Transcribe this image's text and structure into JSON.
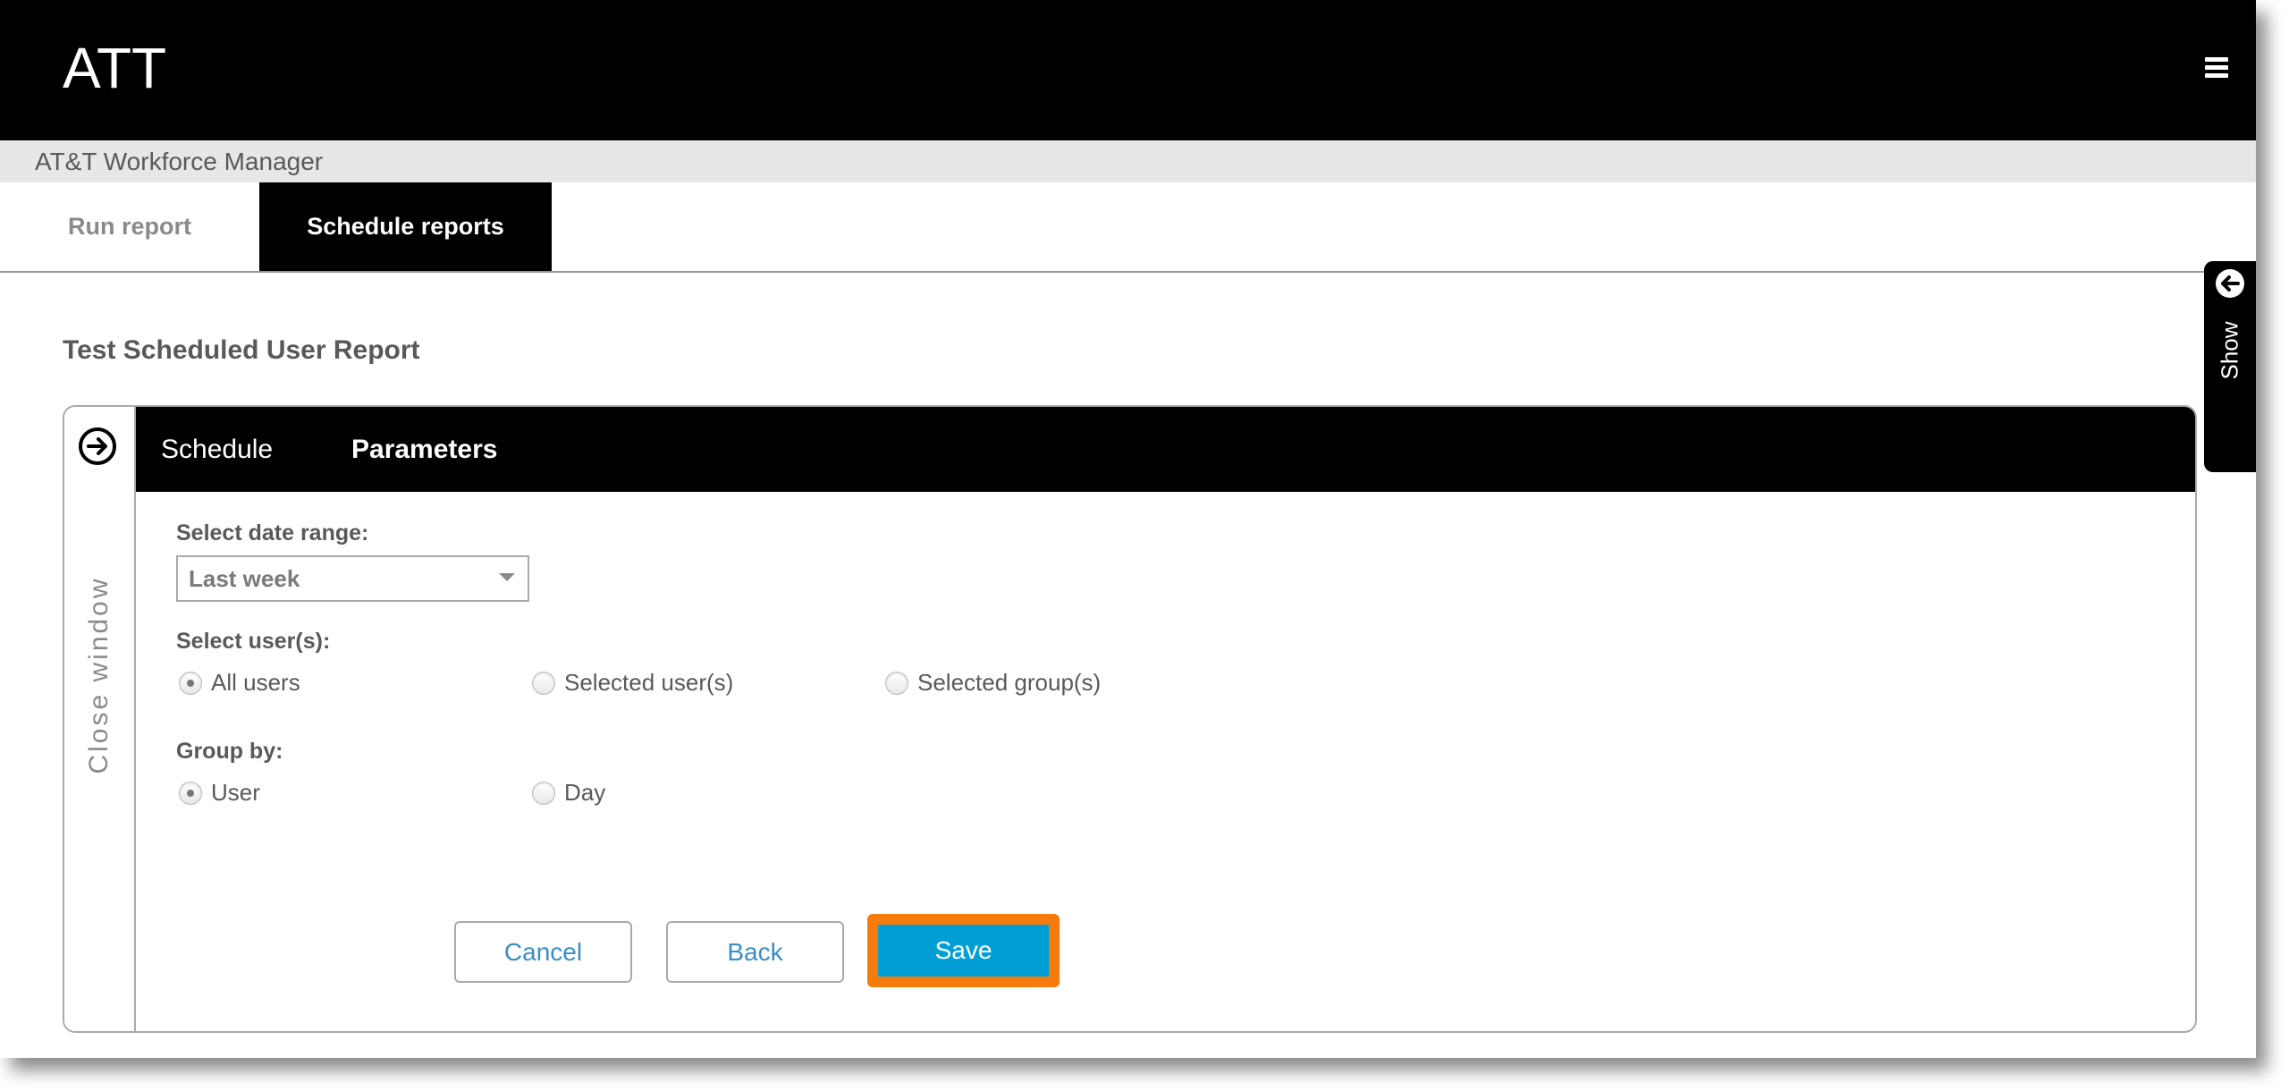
{
  "header": {
    "logo": "ATT",
    "menu_icon": "hamburger-menu-icon"
  },
  "subheader": {
    "app_title": "AT&T Workforce Manager"
  },
  "tabs": [
    {
      "label": "Run report",
      "active": false
    },
    {
      "label": "Schedule reports",
      "active": true
    }
  ],
  "report": {
    "title": "Test Scheduled User Report"
  },
  "panel": {
    "close_label": "Close window",
    "close_icon": "arrow-right-circle-icon",
    "tabs": [
      {
        "label": "Schedule",
        "active": false
      },
      {
        "label": "Parameters",
        "active": true
      }
    ],
    "date_range": {
      "label": "Select date range:",
      "value": "Last week"
    },
    "users": {
      "label": "Select user(s):",
      "options": [
        {
          "label": "All users",
          "checked": true
        },
        {
          "label": "Selected user(s)",
          "checked": false
        },
        {
          "label": "Selected group(s)",
          "checked": false
        }
      ]
    },
    "group_by": {
      "label": "Group by:",
      "options": [
        {
          "label": "User",
          "checked": true
        },
        {
          "label": "Day",
          "checked": false
        }
      ]
    },
    "buttons": {
      "cancel": "Cancel",
      "back": "Back",
      "save": "Save"
    }
  },
  "side_tab": {
    "label": "Show",
    "icon": "arrow-left-circle-icon"
  },
  "colors": {
    "header_bg": "#000000",
    "subheader_bg": "#e6e7e8",
    "primary_button": "#029ed6",
    "highlight_outline": "#f57b0c",
    "link_text": "#3a8ec4"
  }
}
